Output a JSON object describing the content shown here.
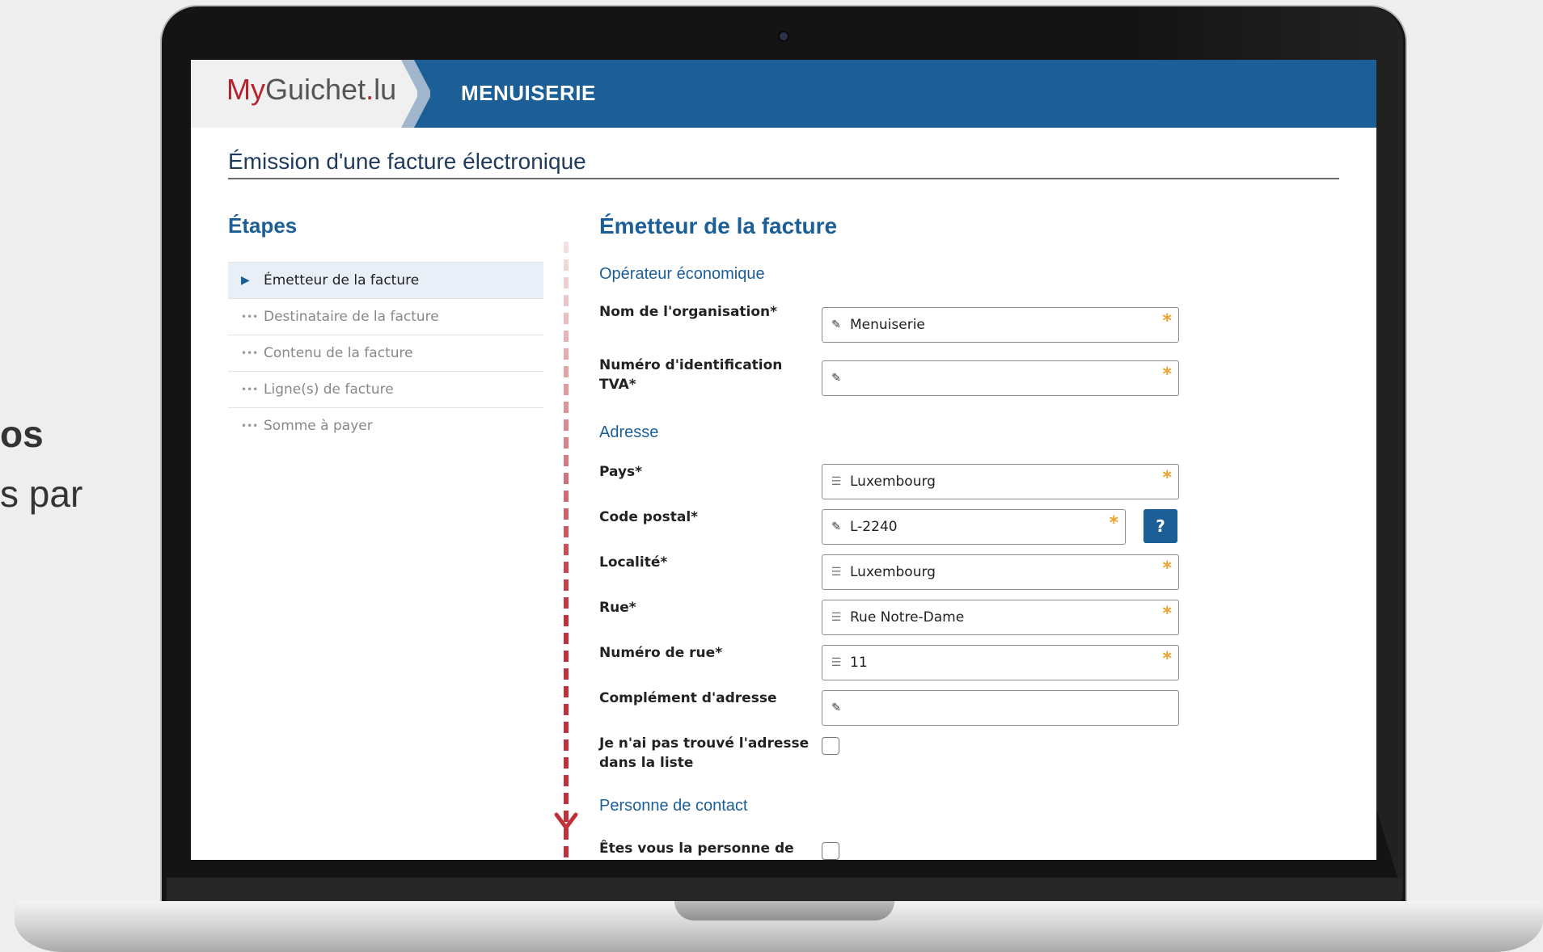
{
  "side_text": {
    "line1": "os",
    "line2": "s par"
  },
  "header": {
    "logo_my": "My",
    "logo_rest": "Guichet",
    "logo_dot": ".",
    "logo_tld": "lu",
    "service": "MENUISERIE"
  },
  "page": {
    "title": "Émission d'une facture électronique"
  },
  "steps": {
    "title": "Étapes",
    "items": [
      {
        "label": "Émetteur de la facture"
      },
      {
        "label": "Destinataire de la facture"
      },
      {
        "label": "Contenu de la facture"
      },
      {
        "label": "Ligne(s) de facture"
      },
      {
        "label": "Somme à payer"
      }
    ]
  },
  "form": {
    "title": "Émetteur de la facture",
    "operator_heading": "Opérateur économique",
    "address_heading": "Adresse",
    "contact_heading": "Personne de contact",
    "required_mark": "*",
    "help_label": "?",
    "fields": {
      "org_name": {
        "label": "Nom de l'organisation*",
        "value": "Menuiserie"
      },
      "vat": {
        "label": "Numéro d'identification TVA*",
        "value": ""
      },
      "country": {
        "label": "Pays*",
        "value": "Luxembourg"
      },
      "postal": {
        "label": "Code postal*",
        "value": "L-2240"
      },
      "locality": {
        "label": "Localité*",
        "value": "Luxembourg"
      },
      "street": {
        "label": "Rue*",
        "value": "Rue Notre-Dame"
      },
      "street_no": {
        "label": "Numéro de rue*",
        "value": "11"
      },
      "complement": {
        "label": "Complément d'adresse",
        "value": ""
      },
      "address_not_found": {
        "label": "Je n'ai pas trouvé l'adresse dans la liste"
      },
      "is_contact": {
        "label": "Êtes vous la personne de"
      }
    }
  },
  "colors": {
    "brand_blue": "#1c5f97",
    "required_orange": "#f0a12b",
    "arrow_red": "#c2313a"
  }
}
